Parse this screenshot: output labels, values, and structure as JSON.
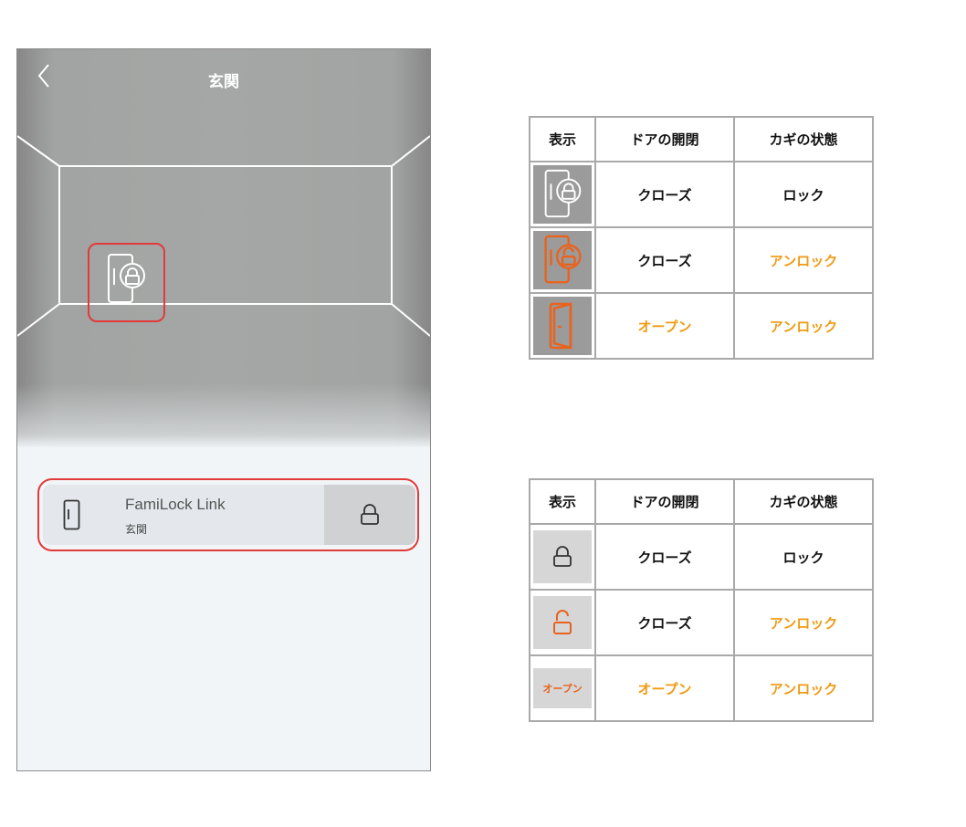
{
  "app": {
    "room_title": "玄関",
    "device": {
      "name": "FamiLock Link",
      "room": "玄関"
    }
  },
  "icons": {
    "back": "chevron-left-icon",
    "door_lock": "door-lock-icon",
    "door": "door-icon",
    "lock": "padlock-icon"
  },
  "colors": {
    "highlight": "#e23a3a",
    "orange_text": "#f09a12",
    "orange_icon": "#e8631e"
  },
  "room_table": {
    "headers": [
      "表示",
      "ドアの開閉",
      "カギの状態"
    ],
    "rows": [
      {
        "icon": "door-closed-locked-icon",
        "door": "クローズ",
        "lock": "ロック"
      },
      {
        "icon": "door-closed-unlocked-icon",
        "door": "クローズ",
        "lock": "アンロック"
      },
      {
        "icon": "door-open-icon",
        "door": "オープン",
        "lock": "アンロック"
      }
    ]
  },
  "card_table": {
    "headers": [
      "表示",
      "ドアの開閉",
      "カギの状態"
    ],
    "rows": [
      {
        "icon": "padlock-closed-icon",
        "door": "クローズ",
        "lock": "ロック"
      },
      {
        "icon": "padlock-open-icon",
        "door": "クローズ",
        "lock": "アンロック"
      },
      {
        "icon_text": "オープン",
        "door": "オープン",
        "lock": "アンロック"
      }
    ]
  }
}
